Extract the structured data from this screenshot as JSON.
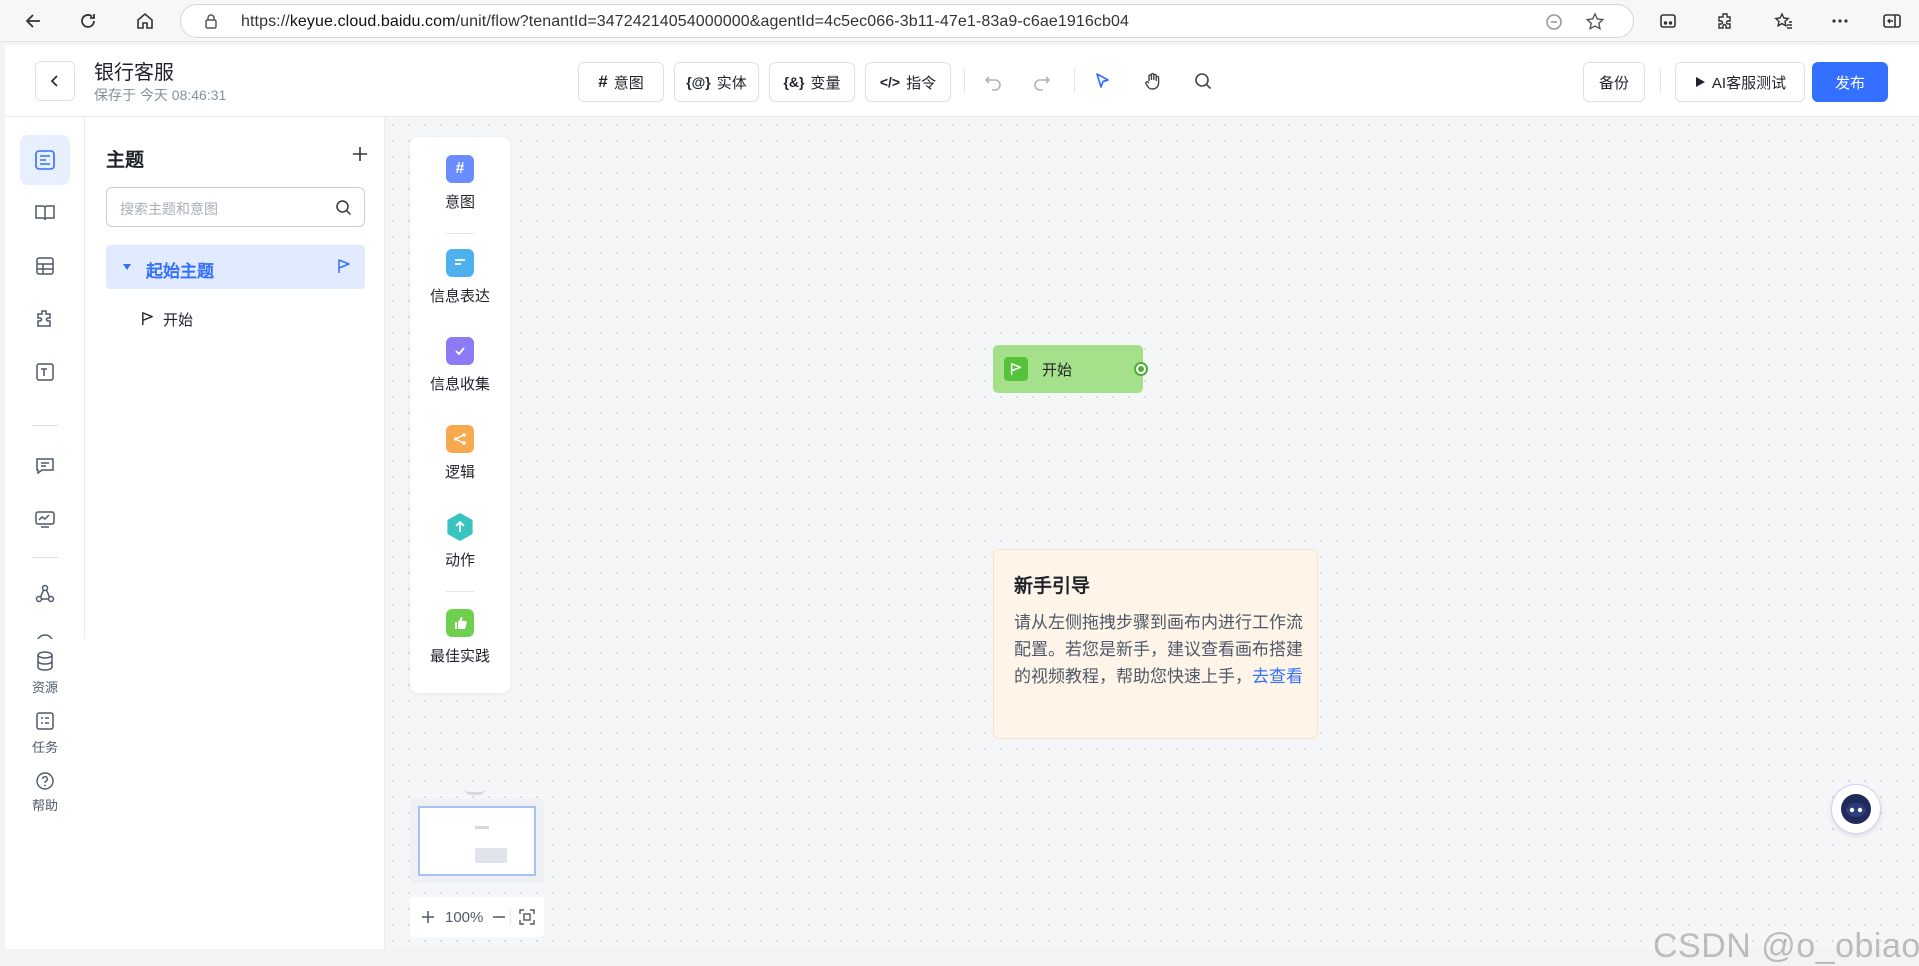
{
  "browser": {
    "url_prefix": "https://",
    "url_domain": "keyue.cloud.baidu.com",
    "url_path": "/unit/flow?tenantId=34724214054000000&agentId=4c5ec066-3b11-47e1-83a9-c6ae1916cb04"
  },
  "header": {
    "title": "银行客服",
    "saved": "保存于 今天 08:46:31",
    "tools": {
      "intent": "意图",
      "entity": "实体",
      "variable": "变量",
      "command": "指令"
    },
    "backup": "备份",
    "test": "AI客服测试",
    "publish": "发布"
  },
  "rail": {
    "resources": "资源",
    "tasks": "任务",
    "help": "帮助"
  },
  "topic_panel": {
    "title": "主题",
    "search_placeholder": "搜索主题和意图",
    "group": "起始主题",
    "child": "开始"
  },
  "palette": {
    "items": [
      {
        "label": "意图",
        "color": "#6b8cff"
      },
      {
        "label": "信息表达",
        "color": "#4fb0ef"
      },
      {
        "label": "信息收集",
        "color": "#8b7cf6"
      },
      {
        "label": "逻辑",
        "color": "#f6a94f"
      },
      {
        "label": "动作",
        "color": "#37c3c0"
      },
      {
        "label": "最佳实践",
        "color": "#6fcf4e"
      }
    ]
  },
  "canvas": {
    "start_node": "开始",
    "guide": {
      "title": "新手引导",
      "body": "请从左侧拖拽步骤到画布内进行工作流配置。若您是新手，建议查看画布搭建的视频教程，帮助您快速上手，",
      "link": "去查看"
    },
    "zoom": "100%"
  },
  "watermark": "CSDN @o_obiao",
  "colors": {
    "primary": "#3370ff",
    "start_node": "#a5e08a",
    "guide_bg": "#fff4e8"
  }
}
